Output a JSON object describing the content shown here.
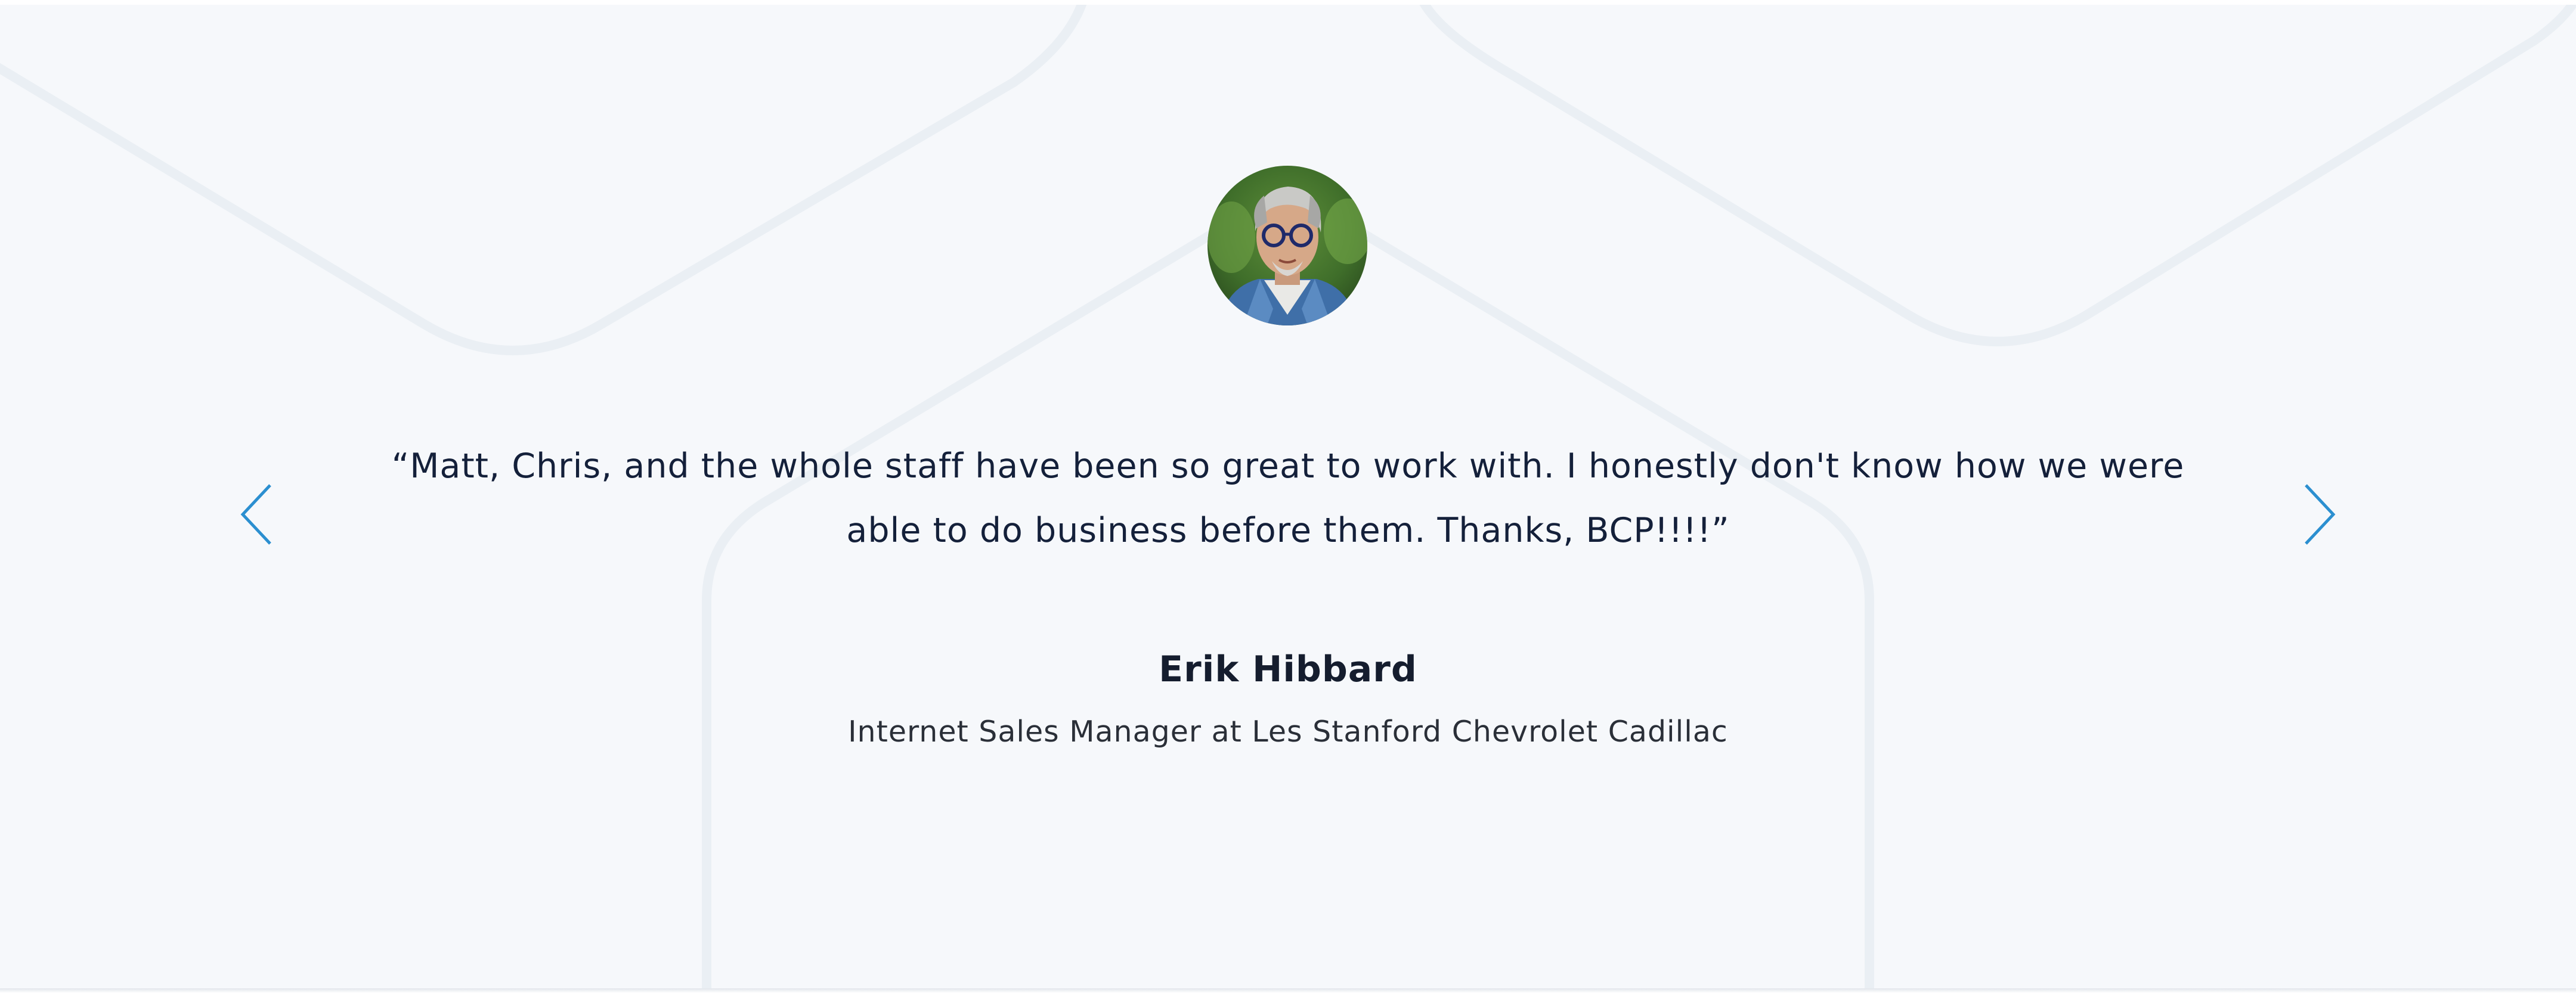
{
  "testimonial": {
    "quote": "“Matt, Chris, and the whole staff have been so great to work with. I honestly don't know how we were able to do business before them. Thanks, BCP!!!!”",
    "author_name": "Erik Hibbard",
    "author_title": "Internet Sales Manager at Les Stanford Chevrolet Cadillac"
  },
  "controls": {
    "prev_icon": "chevron-left-icon",
    "next_icon": "chevron-right-icon"
  },
  "colors": {
    "background": "#f6f8fb",
    "background_lines": "#eaeff4",
    "text_primary": "#14203a",
    "accent_arrow": "#2b8fd0"
  }
}
